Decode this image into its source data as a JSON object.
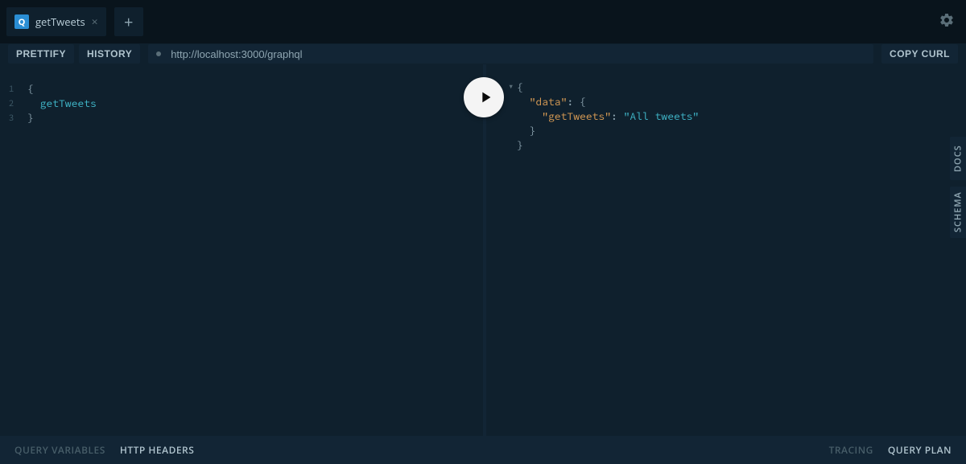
{
  "tabs": {
    "active": {
      "icon_letter": "Q",
      "title": "getTweets"
    }
  },
  "toolbar": {
    "prettify": "PRETTIFY",
    "history": "HISTORY",
    "url": "http://localhost:3000/graphql",
    "copy_curl": "COPY CURL"
  },
  "editor": {
    "line_numbers": [
      "1",
      "2",
      "3"
    ],
    "lines": {
      "l1": "{",
      "l2_indent": "  ",
      "l2_field": "getTweets",
      "l3": "}"
    }
  },
  "result": {
    "l1_open": "{",
    "l2_indent": "  ",
    "l2_key": "\"data\"",
    "l2_colon": ": ",
    "l2_open": "{",
    "l3_indent": "    ",
    "l3_key": "\"getTweets\"",
    "l3_colon": ": ",
    "l3_value": "\"All tweets\"",
    "l4_indent": "  ",
    "l4_close": "}",
    "l5_close": "}"
  },
  "side": {
    "docs": "DOCS",
    "schema": "SCHEMA"
  },
  "bottom": {
    "query_variables": "QUERY VARIABLES",
    "http_headers": "HTTP HEADERS",
    "tracing": "TRACING",
    "query_plan": "QUERY PLAN"
  }
}
